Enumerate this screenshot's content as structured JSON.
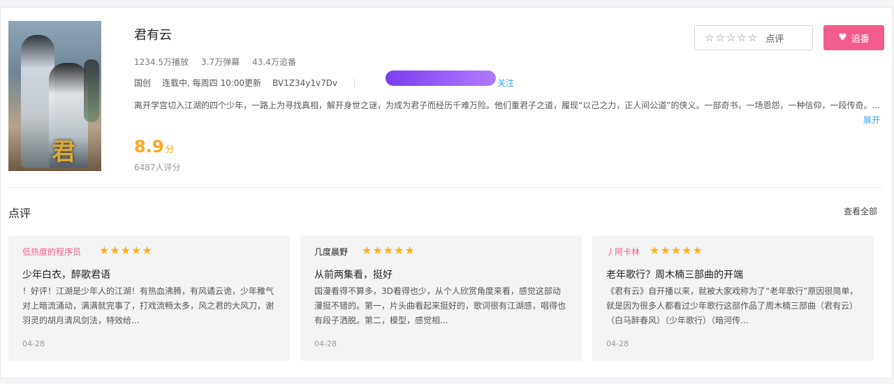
{
  "anime": {
    "title": "君有云",
    "stats": [
      "1234.5万播放",
      "3.7万弹幕",
      "43.4万追番"
    ],
    "meta": [
      "国创",
      "连载中, 每周四 10:00更新",
      "BV1Z34y1v7Dv"
    ],
    "follow_link": "关注",
    "description": "离开学宫切入江湖的四个少年，一路上为寻找真相，解开身世之谜，为成为君子而经历千难万险。他们重君子之道，履现“以己之力，正人间公道”的侠义。一部奇书，一场恩怨，一种信仰，一段传奇。...",
    "expand": "展开",
    "score": "8.9",
    "score_unit": "分",
    "votes": "6487人评分",
    "cover_text": "君"
  },
  "actions": {
    "review_stars": "☆☆☆☆☆",
    "review_label": "点评",
    "follow_label": "追番",
    "follow_color": "#f25d8e"
  },
  "reviews_section": {
    "title": "点评",
    "see_all": "查看全部"
  },
  "reviews": [
    {
      "user": "低热度的程序员",
      "user_color": "#f25d8e",
      "stars": "★★★★★",
      "title": "少年白衣，醉歌君语",
      "body": "！好评！江湖是少年人的江湖！有热血沸腾，有风谲云诡，少年稚气对上暗流涌动，满满就完事了，打戏流畅太多，风之君的大风刀，谢羽灵的胡月清风剑法，特效给...",
      "date": "04-28"
    },
    {
      "user": "几度晨野",
      "user_color": "#222222",
      "stars": "★★★★★",
      "title": "从前两集看，挺好",
      "body": "国漫看得不算多，3D看得也少，从个人欣赏角度来看，感觉这部动漫挺不错的。第一，片头曲看起来挺好的，歌词很有江湖感，唱得也有段子洒脱。第二，模型，感觉相...",
      "date": "04-28"
    },
    {
      "user": "丿阿卡林",
      "user_color": "#f25d8e",
      "stars": "★★★★★",
      "title": "老年歌行？周木楠三部曲的开端",
      "body": "《君有云》自开播以来，就被大家戏称为了“老年歌行”原因很简单，就是因为很多人都看过少年歌行这部作品了周木楠三部曲（君有云）（白马醉春风）（少年歌行）（暗河传...",
      "date": "04-28"
    }
  ]
}
